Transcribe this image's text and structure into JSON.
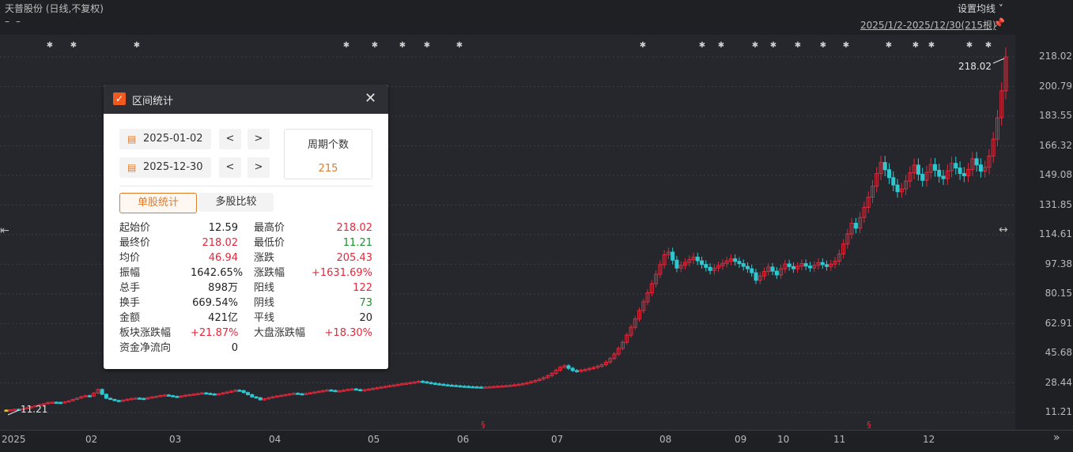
{
  "header": {
    "title": "天普股份 (日线,不复权)",
    "dash": "– –",
    "set_ma_label": "设置均线 ˅",
    "range_label": "2025/1/2-2025/12/30(215根)"
  },
  "y_axis": [
    "218.02",
    "200.79",
    "183.55",
    "166.32",
    "149.08",
    "131.85",
    "114.61",
    "97.38",
    "80.15",
    "62.91",
    "45.68",
    "28.44",
    "11.21"
  ],
  "x_axis": [
    "2025",
    "02",
    "03",
    "04",
    "05",
    "06",
    "07",
    "08",
    "09",
    "10",
    "11",
    "12"
  ],
  "annotations": {
    "max_label": "218.02",
    "min_label": "11.21",
    "event_marker": "§"
  },
  "panel": {
    "title": "区间统计",
    "start_date": "2025-01-02",
    "end_date": "2025-12-30",
    "prev": "<",
    "next": ">",
    "count_label": "周期个数",
    "count_value": "215",
    "tab_single": "单股统计",
    "tab_multi": "多股比较",
    "stats": [
      {
        "l1": "起始价",
        "v1": "12.59",
        "c1": "dark",
        "l2": "最高价",
        "v2": "218.02",
        "c2": "red"
      },
      {
        "l1": "最终价",
        "v1": "218.02",
        "c1": "red",
        "l2": "最低价",
        "v2": "11.21",
        "c2": "green"
      },
      {
        "l1": "均价",
        "v1": "46.94",
        "c1": "red",
        "l2": "涨跌",
        "v2": "205.43",
        "c2": "red"
      },
      {
        "l1": "振幅",
        "v1": "1642.65%",
        "c1": "dark",
        "l2": "涨跌幅",
        "v2": "+1631.69%",
        "c2": "red"
      },
      {
        "l1": "总手",
        "v1": "898万",
        "c1": "dark",
        "l2": "阳线",
        "v2": "122",
        "c2": "red"
      },
      {
        "l1": "换手",
        "v1": "669.54%",
        "c1": "dark",
        "l2": "阴线",
        "v2": "73",
        "c2": "green"
      },
      {
        "l1": "金额",
        "v1": "421亿",
        "c1": "dark",
        "l2": "平线",
        "v2": "20",
        "c2": "dark"
      },
      {
        "l1": "板块涨跌幅",
        "v1": "+21.87%",
        "c1": "red",
        "l2": "大盘涨跌幅",
        "v2": "+18.30%",
        "c2": "red"
      },
      {
        "l1": "资金净流向",
        "v1": "0",
        "c1": "dark",
        "l2": "",
        "v2": "",
        "c2": "dark"
      }
    ]
  },
  "colors": {
    "up": "#e3283b",
    "down": "#2fc8d0",
    "flat": "#e8c33a",
    "panel_accent": "#e07b2a"
  },
  "chart_data": {
    "type": "candlestick",
    "ylim": [
      11.21,
      218.02
    ],
    "series": [
      {
        "month": "01",
        "close": [
          12.6,
          12.8,
          13.1,
          12.9,
          13.4,
          14.0,
          14.6,
          15.2,
          15.8,
          16.3,
          17.0,
          17.2,
          17.1,
          16.9,
          17.4,
          18.0,
          18.8,
          19.6,
          20.4,
          21.0
        ]
      },
      {
        "month": "02",
        "close": [
          20.8,
          22.5,
          24.6,
          21.8,
          19.5,
          18.8,
          18.2,
          17.9,
          18.4,
          18.9,
          19.3,
          19.6,
          19.4,
          19.1,
          19.8,
          20.3,
          20.6,
          21.1,
          21.4
        ]
      },
      {
        "month": "03",
        "close": [
          21.0,
          20.6,
          20.2,
          20.8,
          21.3,
          21.6,
          21.9,
          22.2,
          22.6,
          22.3,
          22.0,
          21.8,
          22.1,
          22.6,
          23.1,
          23.6,
          24.2,
          23.9,
          22.8,
          21.6,
          20.3
        ]
      },
      {
        "month": "04",
        "close": [
          19.8,
          18.6,
          19.2,
          19.8,
          20.4,
          20.8,
          21.2,
          21.6,
          22.0,
          22.4,
          22.1,
          21.9,
          22.3,
          22.7,
          23.1,
          23.5,
          23.9,
          24.3
        ]
      },
      {
        "month": "05",
        "close": [
          24.0,
          23.6,
          23.8,
          24.2,
          24.6,
          24.9,
          24.5,
          24.1,
          24.4,
          24.8,
          25.2,
          25.6,
          26.0,
          26.4,
          26.8,
          27.1,
          27.5,
          27.9,
          28.2
        ]
      },
      {
        "month": "06",
        "close": [
          28.6,
          28.9,
          29.4,
          29.0,
          28.6,
          28.2,
          27.9,
          27.6,
          27.3,
          27.1,
          26.9,
          26.7,
          26.5,
          26.4,
          26.2,
          26.1,
          26.0,
          25.9,
          26.0,
          26.1
        ]
      },
      {
        "month": "07",
        "close": [
          26.3,
          26.5,
          26.6,
          26.8,
          27.0,
          27.3,
          27.6,
          28.0,
          28.5,
          29.1,
          29.8,
          30.6,
          31.5,
          32.6,
          34.0,
          35.8,
          37.5,
          38.4,
          36.9,
          35.6,
          35.2,
          35.8
        ]
      },
      {
        "month": "08",
        "close": [
          36.2,
          36.8,
          37.4,
          38.1,
          39.0,
          40.5,
          42.6,
          45.2,
          48.5,
          52.0,
          56.2,
          60.8,
          65.6,
          70.5,
          75.6,
          80.8,
          86.1,
          91.6,
          97.2,
          103.0
        ]
      },
      {
        "month": "09",
        "close": [
          104.5,
          99.8,
          95.2,
          96.8,
          98.5,
          100.1,
          101.6,
          99.4,
          97.3,
          95.6,
          93.8,
          95.2,
          96.6,
          98.0,
          99.3,
          100.6,
          99.1,
          97.8,
          96.2,
          94.8
        ]
      },
      {
        "month": "10",
        "close": [
          92.5,
          88.1,
          90.6,
          93.2,
          95.8,
          93.4,
          91.2,
          94.8,
          97.6,
          96.1,
          94.8,
          96.3,
          97.8,
          96.4,
          95.3,
          96.8,
          98.4,
          97.2,
          96.1,
          97.5,
          99.2
        ]
      },
      {
        "month": "11",
        "close": [
          103.4,
          109.2,
          115.1,
          121.3,
          118.4,
          124.6,
          130.5,
          136.4,
          142.8,
          150.2,
          156.6,
          152.4,
          147.8,
          143.5,
          139.6,
          141.2,
          145.8,
          150.6,
          155.1,
          149.8
        ]
      },
      {
        "month": "12",
        "close": [
          146.2,
          150.9,
          155.4,
          152.1,
          148.6,
          147.2,
          151.8,
          156.1,
          153.4,
          150.2,
          148.9,
          152.6,
          158.8,
          155.2,
          151.6,
          153.8,
          160.4,
          170.2,
          182.6,
          198.3,
          218.02
        ]
      }
    ]
  }
}
